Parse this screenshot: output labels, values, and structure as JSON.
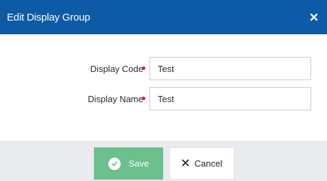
{
  "dialog": {
    "title": "Edit Display Group",
    "close_icon": "close-icon",
    "colors": {
      "header": "#0d5aa7",
      "save_button": "#6cc08b",
      "required_marker": "#d42020",
      "footer": "#e9ebee"
    }
  },
  "form": {
    "display_code": {
      "label": "Display Code",
      "value": "Test",
      "required": true
    },
    "display_name": {
      "label": "Display Name",
      "value": "Test",
      "required": true
    }
  },
  "footer": {
    "save_label": "Save",
    "save_icon": "check-circle-icon",
    "cancel_label": "Cancel",
    "cancel_icon": "x-icon"
  }
}
